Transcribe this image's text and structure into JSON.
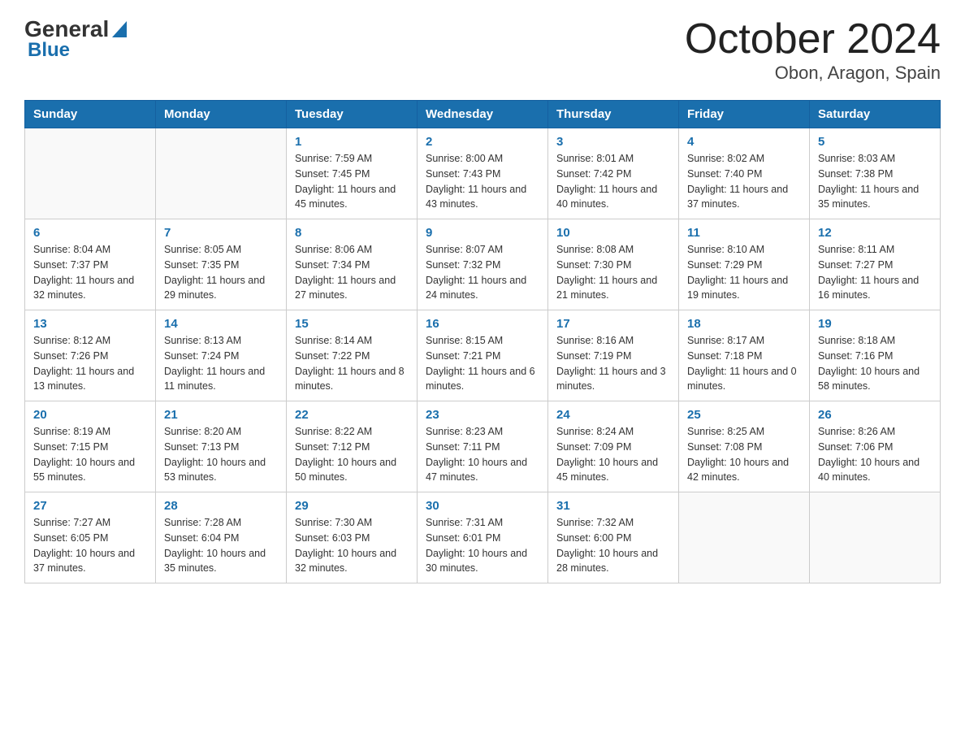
{
  "header": {
    "logo_general": "General",
    "logo_blue": "Blue",
    "month_year": "October 2024",
    "location": "Obon, Aragon, Spain"
  },
  "days_of_week": [
    "Sunday",
    "Monday",
    "Tuesday",
    "Wednesday",
    "Thursday",
    "Friday",
    "Saturday"
  ],
  "weeks": [
    [
      {
        "day": "",
        "info": ""
      },
      {
        "day": "",
        "info": ""
      },
      {
        "day": "1",
        "sunrise": "Sunrise: 7:59 AM",
        "sunset": "Sunset: 7:45 PM",
        "daylight": "Daylight: 11 hours and 45 minutes."
      },
      {
        "day": "2",
        "sunrise": "Sunrise: 8:00 AM",
        "sunset": "Sunset: 7:43 PM",
        "daylight": "Daylight: 11 hours and 43 minutes."
      },
      {
        "day": "3",
        "sunrise": "Sunrise: 8:01 AM",
        "sunset": "Sunset: 7:42 PM",
        "daylight": "Daylight: 11 hours and 40 minutes."
      },
      {
        "day": "4",
        "sunrise": "Sunrise: 8:02 AM",
        "sunset": "Sunset: 7:40 PM",
        "daylight": "Daylight: 11 hours and 37 minutes."
      },
      {
        "day": "5",
        "sunrise": "Sunrise: 8:03 AM",
        "sunset": "Sunset: 7:38 PM",
        "daylight": "Daylight: 11 hours and 35 minutes."
      }
    ],
    [
      {
        "day": "6",
        "sunrise": "Sunrise: 8:04 AM",
        "sunset": "Sunset: 7:37 PM",
        "daylight": "Daylight: 11 hours and 32 minutes."
      },
      {
        "day": "7",
        "sunrise": "Sunrise: 8:05 AM",
        "sunset": "Sunset: 7:35 PM",
        "daylight": "Daylight: 11 hours and 29 minutes."
      },
      {
        "day": "8",
        "sunrise": "Sunrise: 8:06 AM",
        "sunset": "Sunset: 7:34 PM",
        "daylight": "Daylight: 11 hours and 27 minutes."
      },
      {
        "day": "9",
        "sunrise": "Sunrise: 8:07 AM",
        "sunset": "Sunset: 7:32 PM",
        "daylight": "Daylight: 11 hours and 24 minutes."
      },
      {
        "day": "10",
        "sunrise": "Sunrise: 8:08 AM",
        "sunset": "Sunset: 7:30 PM",
        "daylight": "Daylight: 11 hours and 21 minutes."
      },
      {
        "day": "11",
        "sunrise": "Sunrise: 8:10 AM",
        "sunset": "Sunset: 7:29 PM",
        "daylight": "Daylight: 11 hours and 19 minutes."
      },
      {
        "day": "12",
        "sunrise": "Sunrise: 8:11 AM",
        "sunset": "Sunset: 7:27 PM",
        "daylight": "Daylight: 11 hours and 16 minutes."
      }
    ],
    [
      {
        "day": "13",
        "sunrise": "Sunrise: 8:12 AM",
        "sunset": "Sunset: 7:26 PM",
        "daylight": "Daylight: 11 hours and 13 minutes."
      },
      {
        "day": "14",
        "sunrise": "Sunrise: 8:13 AM",
        "sunset": "Sunset: 7:24 PM",
        "daylight": "Daylight: 11 hours and 11 minutes."
      },
      {
        "day": "15",
        "sunrise": "Sunrise: 8:14 AM",
        "sunset": "Sunset: 7:22 PM",
        "daylight": "Daylight: 11 hours and 8 minutes."
      },
      {
        "day": "16",
        "sunrise": "Sunrise: 8:15 AM",
        "sunset": "Sunset: 7:21 PM",
        "daylight": "Daylight: 11 hours and 6 minutes."
      },
      {
        "day": "17",
        "sunrise": "Sunrise: 8:16 AM",
        "sunset": "Sunset: 7:19 PM",
        "daylight": "Daylight: 11 hours and 3 minutes."
      },
      {
        "day": "18",
        "sunrise": "Sunrise: 8:17 AM",
        "sunset": "Sunset: 7:18 PM",
        "daylight": "Daylight: 11 hours and 0 minutes."
      },
      {
        "day": "19",
        "sunrise": "Sunrise: 8:18 AM",
        "sunset": "Sunset: 7:16 PM",
        "daylight": "Daylight: 10 hours and 58 minutes."
      }
    ],
    [
      {
        "day": "20",
        "sunrise": "Sunrise: 8:19 AM",
        "sunset": "Sunset: 7:15 PM",
        "daylight": "Daylight: 10 hours and 55 minutes."
      },
      {
        "day": "21",
        "sunrise": "Sunrise: 8:20 AM",
        "sunset": "Sunset: 7:13 PM",
        "daylight": "Daylight: 10 hours and 53 minutes."
      },
      {
        "day": "22",
        "sunrise": "Sunrise: 8:22 AM",
        "sunset": "Sunset: 7:12 PM",
        "daylight": "Daylight: 10 hours and 50 minutes."
      },
      {
        "day": "23",
        "sunrise": "Sunrise: 8:23 AM",
        "sunset": "Sunset: 7:11 PM",
        "daylight": "Daylight: 10 hours and 47 minutes."
      },
      {
        "day": "24",
        "sunrise": "Sunrise: 8:24 AM",
        "sunset": "Sunset: 7:09 PM",
        "daylight": "Daylight: 10 hours and 45 minutes."
      },
      {
        "day": "25",
        "sunrise": "Sunrise: 8:25 AM",
        "sunset": "Sunset: 7:08 PM",
        "daylight": "Daylight: 10 hours and 42 minutes."
      },
      {
        "day": "26",
        "sunrise": "Sunrise: 8:26 AM",
        "sunset": "Sunset: 7:06 PM",
        "daylight": "Daylight: 10 hours and 40 minutes."
      }
    ],
    [
      {
        "day": "27",
        "sunrise": "Sunrise: 7:27 AM",
        "sunset": "Sunset: 6:05 PM",
        "daylight": "Daylight: 10 hours and 37 minutes."
      },
      {
        "day": "28",
        "sunrise": "Sunrise: 7:28 AM",
        "sunset": "Sunset: 6:04 PM",
        "daylight": "Daylight: 10 hours and 35 minutes."
      },
      {
        "day": "29",
        "sunrise": "Sunrise: 7:30 AM",
        "sunset": "Sunset: 6:03 PM",
        "daylight": "Daylight: 10 hours and 32 minutes."
      },
      {
        "day": "30",
        "sunrise": "Sunrise: 7:31 AM",
        "sunset": "Sunset: 6:01 PM",
        "daylight": "Daylight: 10 hours and 30 minutes."
      },
      {
        "day": "31",
        "sunrise": "Sunrise: 7:32 AM",
        "sunset": "Sunset: 6:00 PM",
        "daylight": "Daylight: 10 hours and 28 minutes."
      },
      {
        "day": "",
        "info": ""
      },
      {
        "day": "",
        "info": ""
      }
    ]
  ]
}
